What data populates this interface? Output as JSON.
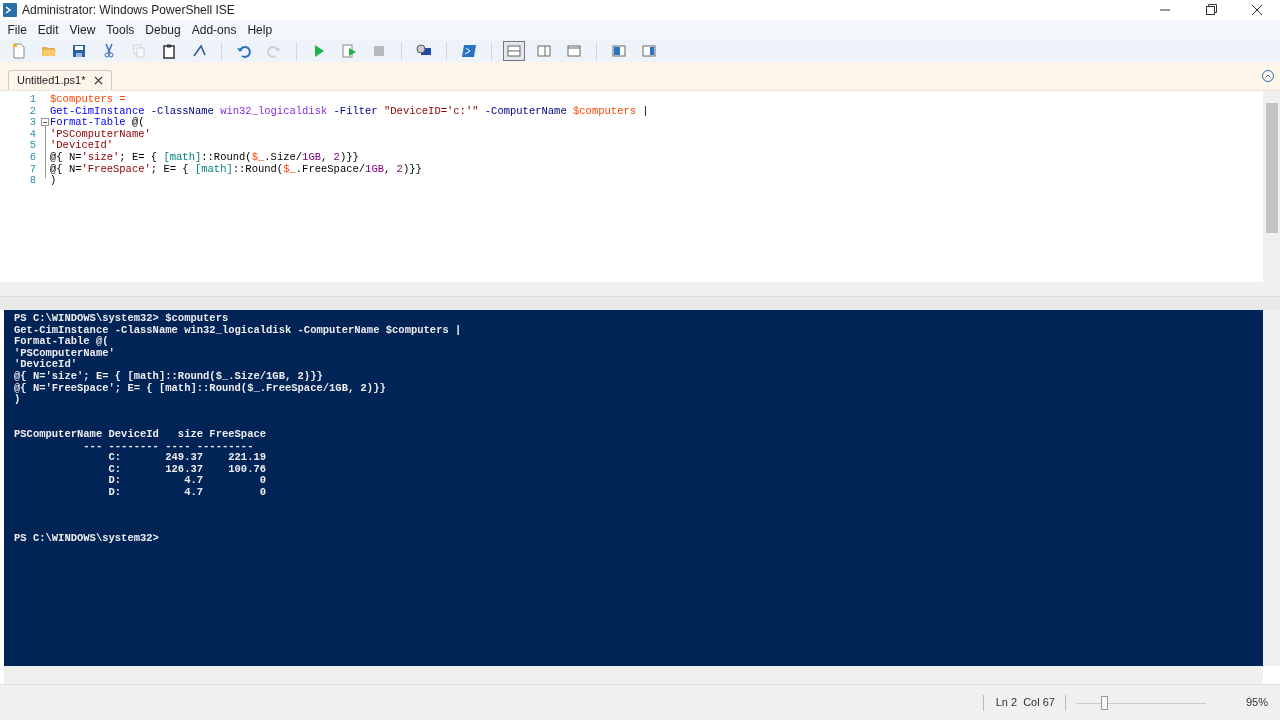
{
  "window": {
    "title": "Administrator: Windows PowerShell ISE"
  },
  "menu": [
    "File",
    "Edit",
    "View",
    "Tools",
    "Debug",
    "Add-ons",
    "Help"
  ],
  "toolbar": [
    {
      "kind": "new",
      "disabled": false
    },
    {
      "kind": "open",
      "disabled": false
    },
    {
      "kind": "save",
      "disabled": false
    },
    {
      "kind": "cut",
      "disabled": false
    },
    {
      "kind": "copy",
      "disabled": true
    },
    {
      "kind": "paste",
      "disabled": false
    },
    {
      "kind": "clear",
      "disabled": false
    },
    {
      "kind": "sep"
    },
    {
      "kind": "undo",
      "disabled": false
    },
    {
      "kind": "redo",
      "disabled": true
    },
    {
      "kind": "sep"
    },
    {
      "kind": "run",
      "disabled": false
    },
    {
      "kind": "runsel",
      "disabled": false
    },
    {
      "kind": "stop",
      "disabled": true
    },
    {
      "kind": "sep"
    },
    {
      "kind": "remote",
      "disabled": false
    },
    {
      "kind": "sep"
    },
    {
      "kind": "console",
      "disabled": false
    },
    {
      "kind": "sep"
    },
    {
      "kind": "paneTop",
      "disabled": false,
      "selected": true
    },
    {
      "kind": "paneRight",
      "disabled": false,
      "selected": false
    },
    {
      "kind": "paneMax",
      "disabled": false,
      "selected": false
    },
    {
      "kind": "sep"
    },
    {
      "kind": "cmdAddon",
      "disabled": false
    },
    {
      "kind": "showAddon",
      "disabled": false
    }
  ],
  "tabs": [
    {
      "label": "Untitled1.ps1*",
      "selected": true
    }
  ],
  "editor": {
    "lines": [
      {
        "number": "1",
        "collapsible": false,
        "tokens": [
          {
            "kind": "var",
            "t": "$computers ="
          }
        ]
      },
      {
        "number": "2",
        "collapsible": false,
        "tokens": [
          {
            "kind": "cmd",
            "t": "Get-CimInstance"
          },
          {
            "kind": "param",
            "t": " -ClassName"
          },
          {
            "kind": "arg",
            "t": " win32_logicaldisk"
          },
          {
            "kind": "param",
            "t": " -Filter"
          },
          {
            "kind": "str",
            "t": " \"DeviceID='c:'\""
          },
          {
            "kind": "param",
            "t": " -ComputerName"
          },
          {
            "kind": "var",
            "t": " $computers"
          },
          {
            "kind": "plain",
            "t": " |"
          }
        ]
      },
      {
        "number": "3",
        "collapsible": true,
        "tokens": [
          {
            "kind": "cmd",
            "t": "Format-Table"
          },
          {
            "kind": "plain",
            "t": " @("
          }
        ]
      },
      {
        "number": "4",
        "collapsible": false,
        "tokens": [
          {
            "kind": "str",
            "t": "'PSComputerName'"
          }
        ]
      },
      {
        "number": "5",
        "collapsible": false,
        "tokens": [
          {
            "kind": "str",
            "t": "'DeviceId'"
          }
        ]
      },
      {
        "number": "6",
        "collapsible": false,
        "tokens": [
          {
            "kind": "plain",
            "t": "@{ N="
          },
          {
            "kind": "str",
            "t": "'size'"
          },
          {
            "kind": "plain",
            "t": "; E= { "
          },
          {
            "kind": "type",
            "t": "[math]"
          },
          {
            "kind": "plain",
            "t": "::Round("
          },
          {
            "kind": "var",
            "t": "$_"
          },
          {
            "kind": "plain",
            "t": ".Size/"
          },
          {
            "kind": "num",
            "t": "1GB"
          },
          {
            "kind": "plain",
            "t": ", "
          },
          {
            "kind": "num",
            "t": "2"
          },
          {
            "kind": "plain",
            "t": ")}}"
          }
        ]
      },
      {
        "number": "7",
        "collapsible": false,
        "tokens": [
          {
            "kind": "plain",
            "t": "@{ N="
          },
          {
            "kind": "str",
            "t": "'FreeSpace'"
          },
          {
            "kind": "plain",
            "t": "; E= { "
          },
          {
            "kind": "type",
            "t": "[math]"
          },
          {
            "kind": "plain",
            "t": "::Round("
          },
          {
            "kind": "var",
            "t": "$_"
          },
          {
            "kind": "plain",
            "t": ".FreeSpace/"
          },
          {
            "kind": "num",
            "t": "1GB"
          },
          {
            "kind": "plain",
            "t": ", "
          },
          {
            "kind": "num",
            "t": "2"
          },
          {
            "kind": "plain",
            "t": ")}}"
          }
        ]
      },
      {
        "number": "8",
        "collapsible": false,
        "tokens": [
          {
            "kind": "plain",
            "t": ")"
          }
        ]
      }
    ]
  },
  "console": {
    "echo": [
      "PS C:\\WINDOWS\\system32> $computers",
      "Get-CimInstance -ClassName win32_logicaldisk -ComputerName $computers |",
      "Format-Table @(",
      "'PSComputerName'",
      "'DeviceId'",
      "@{ N='size'; E= { [math]::Round($_.Size/1GB, 2)}}",
      "@{ N='FreeSpace'; E= { [math]::Round($_.FreeSpace/1GB, 2)}}",
      ")"
    ],
    "output": [
      "PSComputerName DeviceId   size FreeSpace",
      "           --- -------- ---- ---------",
      "               C:       249.37    221.19",
      "               C:       126.37    100.76",
      "               D:          4.7         0",
      "               D:          4.7         0"
    ],
    "prompt": "PS C:\\WINDOWS\\system32>"
  },
  "status_bar": {
    "position": "Ln 2  Col 67",
    "zoom": {
      "level": 0.2,
      "reading": "95%"
    }
  }
}
